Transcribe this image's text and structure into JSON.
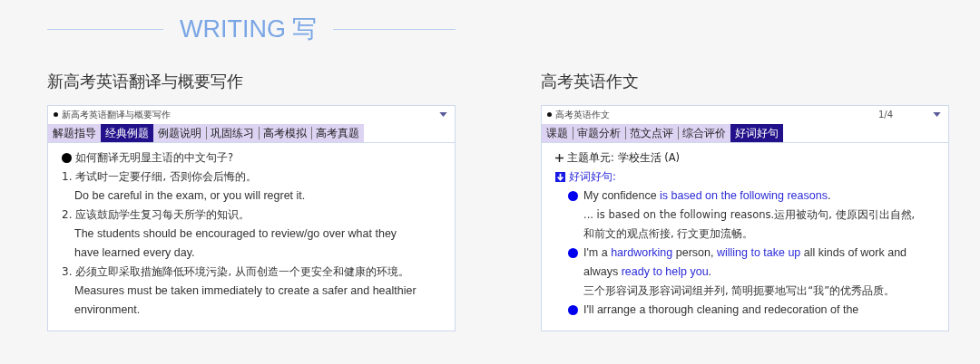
{
  "banner": {
    "title": "WRITING 写"
  },
  "panels": [
    {
      "heading": "新高考英语翻译与概要写作",
      "card": {
        "title": "新高考英语翻译与概要写作",
        "tabs": [
          {
            "label": "解题指导",
            "selected": false
          },
          {
            "label": "经典例题",
            "selected": true
          },
          {
            "label": "例题说明",
            "selected": false
          },
          {
            "label": "巩固练习",
            "selected": false
          },
          {
            "label": "高考模拟",
            "selected": false
          },
          {
            "label": "高考真题",
            "selected": false
          }
        ],
        "lines": [
          {
            "kind": "question",
            "text": "如何翻译无明显主语的中文句子?"
          },
          {
            "kind": "item",
            "number": "1.",
            "chinese": "考试时一定要仔细, 否则你会后悔的。",
            "english": "Do be careful in the exam, or you will regret it."
          },
          {
            "kind": "item",
            "number": "2.",
            "chinese": "应该鼓励学生复习每天所学的知识。",
            "english": "The students should be encouraged to review/go over what they have learned every day."
          },
          {
            "kind": "item",
            "number": "3.",
            "chinese": "必须立即采取措施降低环境污染, 从而创造一个更安全和健康的环境。",
            "english": "Measures must be taken immediately to create a safer and healthier environment."
          }
        ]
      }
    },
    {
      "heading": "高考英语作文",
      "card": {
        "title": "高考英语作文",
        "page": "1/4",
        "tabs": [
          {
            "label": "课题",
            "selected": false
          },
          {
            "label": "审题分析",
            "selected": false
          },
          {
            "label": "范文点评",
            "selected": false
          },
          {
            "label": "综合评价",
            "selected": false
          },
          {
            "label": "好词好句",
            "selected": true
          }
        ],
        "lines": [
          {
            "kind": "topic",
            "text": "主题单元: 学校生活 (A)"
          },
          {
            "kind": "section",
            "text": "好词好句:"
          },
          {
            "kind": "sentence",
            "segments": [
              {
                "text": "My confidence ",
                "highlight": false
              },
              {
                "text": "is based on the following reasons",
                "highlight": true
              },
              {
                "text": ".",
                "highlight": false
              }
            ],
            "notes": [
              "... is based on the following reasons.运用被动句, 使原因引出自然, 和前文的观点衔接, 行文更加流畅。"
            ]
          },
          {
            "kind": "sentence",
            "segments": [
              {
                "text": "I'm a ",
                "highlight": false
              },
              {
                "text": "hardworking",
                "highlight": true
              },
              {
                "text": " person, ",
                "highlight": false
              },
              {
                "text": "willing to take up",
                "highlight": true
              },
              {
                "text": " all kinds of work and always ",
                "highlight": false
              },
              {
                "text": "ready to help you",
                "highlight": true
              },
              {
                "text": ".",
                "highlight": false
              }
            ],
            "notes": [
              "三个形容词及形容词词组并列, 简明扼要地写出“我”的优秀品质。"
            ]
          },
          {
            "kind": "sentence",
            "segments": [
              {
                "text": "I'll arrange a thorough cleaning and redecoration of the",
                "highlight": false
              }
            ]
          }
        ]
      }
    }
  ]
}
